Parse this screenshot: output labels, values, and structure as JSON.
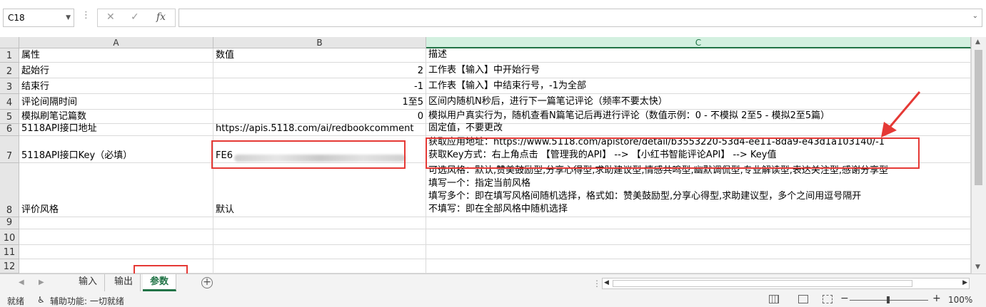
{
  "formula_bar": {
    "name_box": "C18",
    "cancel_icon": "✕",
    "enter_icon": "✓",
    "fx_label": "fx",
    "formula_value": ""
  },
  "columns": [
    "A",
    "B",
    "C"
  ],
  "selected_column": "C",
  "rows": [
    {
      "num": "1",
      "a": "属性",
      "b": "数值",
      "c": [
        "描述"
      ]
    },
    {
      "num": "2",
      "a": "起始行",
      "b": "2",
      "c": [
        "工作表【输入】中开始行号"
      ]
    },
    {
      "num": "3",
      "a": "结束行",
      "b": "-1",
      "c": [
        "工作表【输入】中结束行号，-1为全部"
      ]
    },
    {
      "num": "4",
      "a": "评论间隔时间",
      "b": "1至5",
      "c": [
        "区间内随机N秒后，进行下一篇笔记评论（频率不要太快）"
      ]
    },
    {
      "num": "5",
      "a": "模拟刷笔记篇数",
      "b": "0",
      "c": [
        "模拟用户真实行为，随机查看N篇笔记后再进行评论（数值示例：0 - 不模拟  2至5 - 模拟2至5篇）"
      ]
    },
    {
      "num": "6",
      "a": "5118API接口地址",
      "b": "https://apis.5118.com/ai/redbookcomment",
      "c": [
        "固定值，不要更改"
      ]
    },
    {
      "num": "7",
      "a": "5118API接口Key（必填）",
      "b": "FE6",
      "c": [
        "获取应用地址：https://www.5118.com/apistore/detail/b3553220-53d4-ee11-8da9-e43d1a103140/-1",
        "获取Key方式：右上角点击 【管理我的API】 --> 【小红书智能评论API】 --> Key值"
      ]
    },
    {
      "num": "8",
      "a": "评价风格",
      "b": "默认",
      "c": [
        "可选风格：默认,赞美鼓励型,分享心得型,求助建议型,情感共鸣型,幽默调侃型,专业解读型,表达关注型,感谢分享型",
        "填写一个：指定当前风格",
        "填写多个：即在填写风格间随机选择，格式如：赞美鼓励型,分享心得型,求助建议型，多个之间用逗号隔开",
        "不填写：即在全部风格中随机选择"
      ]
    },
    {
      "num": "9",
      "a": "",
      "b": "",
      "c": [
        ""
      ]
    },
    {
      "num": "10",
      "a": "",
      "b": "",
      "c": [
        ""
      ]
    },
    {
      "num": "11",
      "a": "",
      "b": "",
      "c": [
        ""
      ]
    },
    {
      "num": "12",
      "a": "",
      "b": "",
      "c": [
        ""
      ]
    }
  ],
  "sheet_tabs": [
    "输入",
    "输出",
    "参数"
  ],
  "active_tab": "参数",
  "status": {
    "ready": "就绪",
    "accessibility": "辅助功能: 一切就绪",
    "zoom": "100%",
    "zoom_minus": "−",
    "zoom_plus": "+"
  },
  "annotation_color": "#e53935",
  "accent_color": "#217346"
}
